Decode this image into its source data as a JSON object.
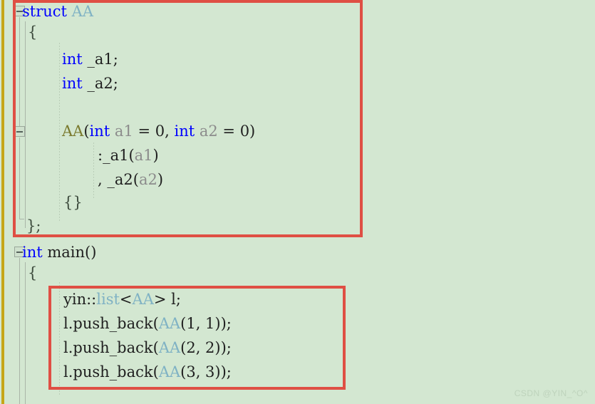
{
  "editor": {
    "background_color": "#d3e7d1",
    "change_bar_color": "#c6a618",
    "annotation_color": "#df4f44"
  },
  "code": {
    "lines": [
      {
        "id": "line-struct-aa",
        "tokens": [
          {
            "text": "struct ",
            "kind": "keyword"
          },
          {
            "text": "AA",
            "kind": "type-id"
          }
        ],
        "plain": "struct AA"
      },
      {
        "id": "line-struct-open-brace",
        "tokens": [
          {
            "text": "{",
            "kind": "brace"
          }
        ],
        "plain": "{"
      },
      {
        "id": "line-member-a1",
        "tokens": [
          {
            "text": "int",
            "kind": "keyword"
          },
          {
            "text": " _a1;",
            "kind": "plain"
          }
        ],
        "plain": "int _a1;"
      },
      {
        "id": "line-member-a2",
        "tokens": [
          {
            "text": "int",
            "kind": "keyword"
          },
          {
            "text": " _a2;",
            "kind": "plain"
          }
        ],
        "plain": "int _a2;"
      },
      {
        "id": "line-blank",
        "tokens": [],
        "plain": ""
      },
      {
        "id": "line-ctor-signature",
        "tokens": [
          {
            "text": "AA",
            "kind": "usertype"
          },
          {
            "text": "(",
            "kind": "plain"
          },
          {
            "text": "int",
            "kind": "keyword"
          },
          {
            "text": " ",
            "kind": "plain"
          },
          {
            "text": "a1",
            "kind": "param"
          },
          {
            "text": " = 0, ",
            "kind": "plain"
          },
          {
            "text": "int",
            "kind": "keyword"
          },
          {
            "text": " ",
            "kind": "plain"
          },
          {
            "text": "a2",
            "kind": "param"
          },
          {
            "text": " = 0)",
            "kind": "plain"
          }
        ],
        "plain": "AA(int a1 = 0, int a2 = 0)"
      },
      {
        "id": "line-init-a1",
        "tokens": [
          {
            "text": ":_a1(",
            "kind": "plain"
          },
          {
            "text": "a1",
            "kind": "param"
          },
          {
            "text": ")",
            "kind": "plain"
          }
        ],
        "plain": ":_a1(a1)"
      },
      {
        "id": "line-init-a2",
        "tokens": [
          {
            "text": ", _a2(",
            "kind": "plain"
          },
          {
            "text": "a2",
            "kind": "param"
          },
          {
            "text": ")",
            "kind": "plain"
          }
        ],
        "plain": ", _a2(a2)"
      },
      {
        "id": "line-ctor-body",
        "tokens": [
          {
            "text": "{}",
            "kind": "brace"
          }
        ],
        "plain": "{}"
      },
      {
        "id": "line-struct-close",
        "tokens": [
          {
            "text": "};",
            "kind": "brace"
          }
        ],
        "plain": "};"
      },
      {
        "id": "line-int-main",
        "tokens": [
          {
            "text": "int",
            "kind": "keyword"
          },
          {
            "text": " main()",
            "kind": "plain"
          }
        ],
        "plain": "int main()"
      },
      {
        "id": "line-main-open-brace",
        "tokens": [
          {
            "text": "{",
            "kind": "brace"
          }
        ],
        "plain": "{"
      },
      {
        "id": "line-list-decl",
        "tokens": [
          {
            "text": "yin::",
            "kind": "ns"
          },
          {
            "text": "list",
            "kind": "type-id"
          },
          {
            "text": "<",
            "kind": "plain"
          },
          {
            "text": "AA",
            "kind": "type-id"
          },
          {
            "text": "> l;",
            "kind": "plain"
          }
        ],
        "plain": "yin::list<AA> l;"
      },
      {
        "id": "line-push-back-1",
        "tokens": [
          {
            "text": "l.push_back(",
            "kind": "plain"
          },
          {
            "text": "AA",
            "kind": "type-id"
          },
          {
            "text": "(1, 1));",
            "kind": "plain"
          }
        ],
        "plain": "l.push_back(AA(1, 1));"
      },
      {
        "id": "line-push-back-2",
        "tokens": [
          {
            "text": "l.push_back(",
            "kind": "plain"
          },
          {
            "text": "AA",
            "kind": "type-id"
          },
          {
            "text": "(2, 2));",
            "kind": "plain"
          }
        ],
        "plain": "l.push_back(AA(2, 2));"
      },
      {
        "id": "line-push-back-3",
        "tokens": [
          {
            "text": "l.push_back(",
            "kind": "plain"
          },
          {
            "text": "AA",
            "kind": "type-id"
          },
          {
            "text": "(3, 3));",
            "kind": "plain"
          }
        ],
        "plain": "l.push_back(AA(3, 3));"
      }
    ]
  },
  "gutter": {
    "fold_struct_label": "collapse-struct-aa",
    "fold_ctor_label": "collapse-constructor",
    "fold_main_label": "collapse-main"
  },
  "annotations": [
    {
      "id": "highlight-struct-definition"
    },
    {
      "id": "highlight-push-back-calls"
    }
  ],
  "watermark": {
    "text": "CSDN @YIN_^O^"
  }
}
